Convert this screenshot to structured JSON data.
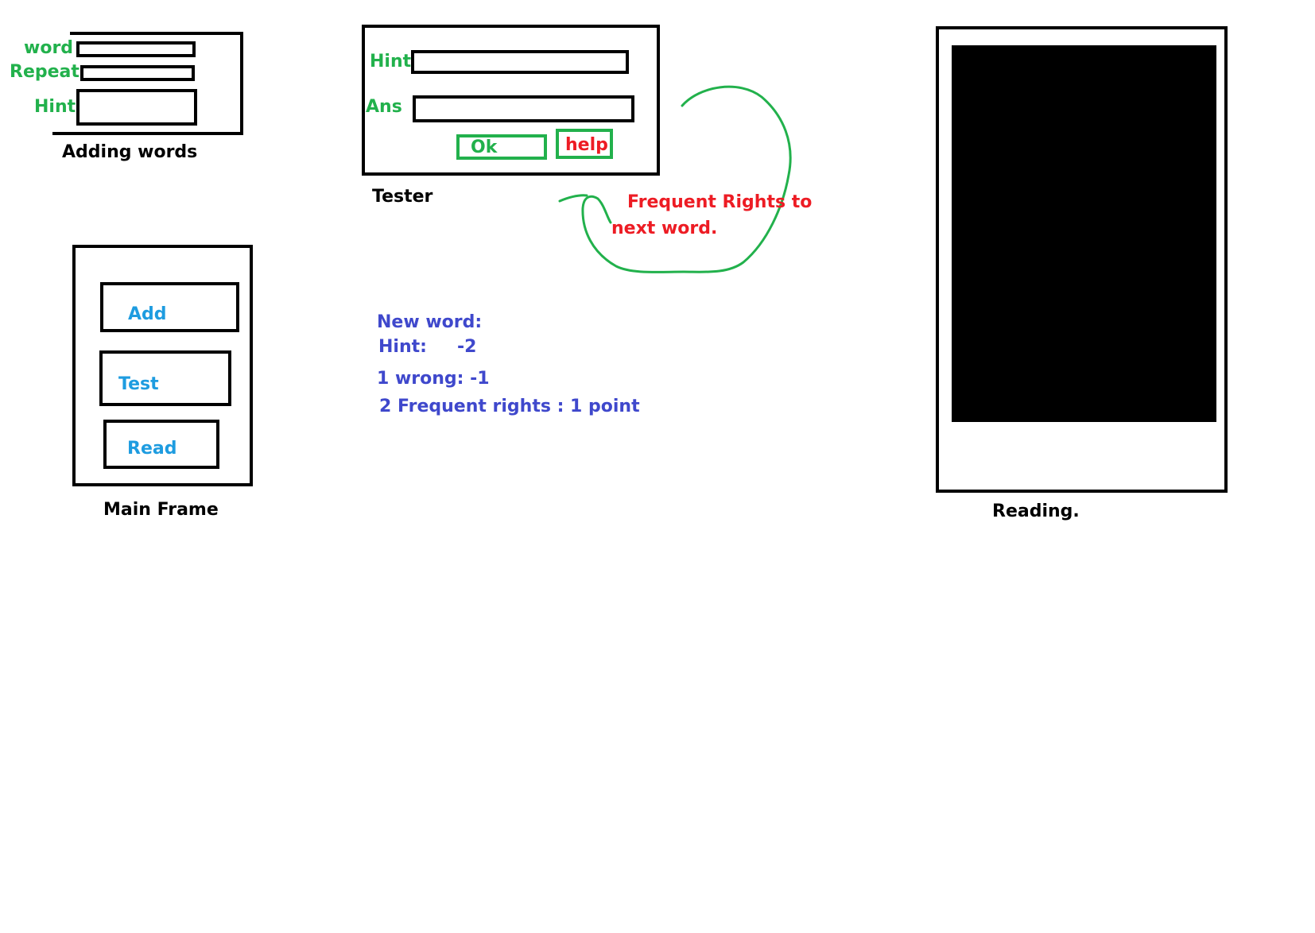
{
  "adding_words": {
    "caption": "Adding words",
    "word_label": "word",
    "repeat_label": "Repeat",
    "hint_label": "Hint"
  },
  "tester": {
    "caption": "Tester",
    "hint_label": "Hint",
    "ans_label": "Ans",
    "ok_label": "Ok",
    "help_label": "help"
  },
  "annotation": {
    "line1": "Frequent Rights to",
    "line2": "next word."
  },
  "scoring": {
    "new_word": "New word:",
    "hint_label": "Hint:",
    "hint_value": "-2",
    "wrong": "1 wrong: -1",
    "rights": "2 Frequent rights : 1 point"
  },
  "main_frame": {
    "caption": "Main Frame",
    "add_label": "Add",
    "test_label": "Test",
    "read_label": "Read"
  },
  "reading": {
    "caption": "Reading."
  },
  "colors": {
    "green": "#22b14c",
    "red": "#ed1c24",
    "cyan": "#1e9ce0",
    "blue": "#3f48cc",
    "black": "#000000"
  }
}
